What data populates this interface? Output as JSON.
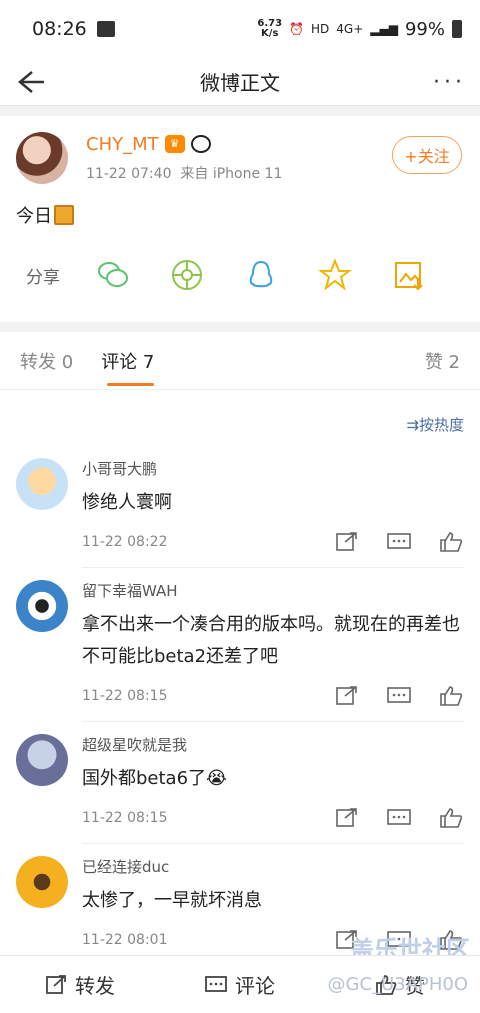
{
  "status": {
    "time": "08:26",
    "speed_top": "6.73",
    "speed_bottom": "K/s",
    "hd": "HD",
    "net": "4G+",
    "battery": "99%"
  },
  "nav": {
    "title": "微博正文",
    "more": "···"
  },
  "post": {
    "author": "CHY_MT",
    "time": "11-22 07:40",
    "source": "来自 iPhone 11",
    "follow_label": "+关注",
    "text": "今日"
  },
  "share": {
    "label": "分享",
    "icons": [
      "wechat-icon",
      "moments-icon",
      "qq-icon",
      "qzone-icon",
      "save-image-icon"
    ]
  },
  "tabs": {
    "repost": "转发 0",
    "comments": "评论 7",
    "likes": "赞 2"
  },
  "sort": {
    "label": "⇉按热度"
  },
  "comments": [
    {
      "name": "小哥哥大鹏",
      "text": "惨绝人寰啊",
      "time": "11-22 08:22"
    },
    {
      "name": "留下幸福WAH",
      "text": "拿不出来一个凑合用的版本吗。就现在的再差也不可能比beta2还差了吧",
      "time": "11-22 08:15"
    },
    {
      "name": "超级星吹就是我",
      "text": "国外都beta6了😭",
      "time": "11-22 08:15"
    },
    {
      "name": "已经连接duc",
      "text": "太惨了，一早就坏消息",
      "time": "11-22 08:01"
    }
  ],
  "bottom": {
    "repost": "转发",
    "comment": "评论",
    "like": "赞"
  },
  "watermark": {
    "line1": "盖乐世社区",
    "line2": "@GC_U3APH0O"
  },
  "colors": {
    "accent": "#f77b22",
    "link": "#4a6fa5"
  }
}
